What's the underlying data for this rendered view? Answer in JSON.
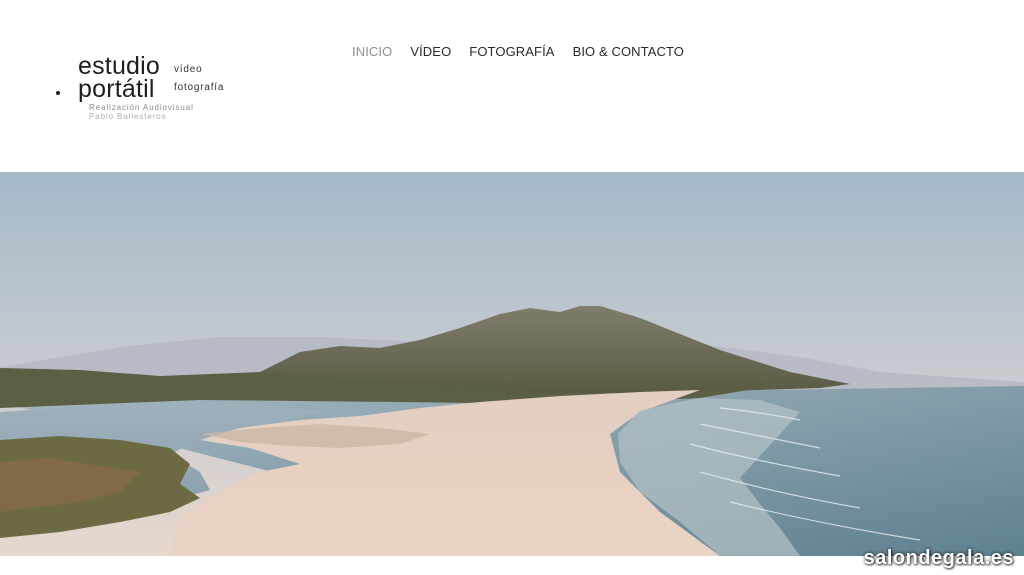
{
  "logo": {
    "word1": "estudio",
    "word2": "portátil",
    "side1": "vídeo",
    "side2": "fotografía",
    "subtitle1": "Realización Audiovisual",
    "subtitle2": "Pablo Ballesteros"
  },
  "nav": {
    "items": [
      {
        "label": "INICIO",
        "active": true
      },
      {
        "label": "VÍDEO"
      },
      {
        "label": "FOTOGRAFÍA"
      },
      {
        "label": "BIO & CONTACTO"
      }
    ]
  },
  "hero": {
    "description_icon": "landscape-photo"
  },
  "watermark": "salondegala.es",
  "colors": {
    "nav_active": "#8f8f8f",
    "nav_text": "#2a2a2a",
    "sky_top": "#a8bccb",
    "sky_bottom": "#e2d6cc",
    "mountain": "#6f6a58",
    "sand": "#e6cfc0",
    "sea": "#7a96a6"
  }
}
